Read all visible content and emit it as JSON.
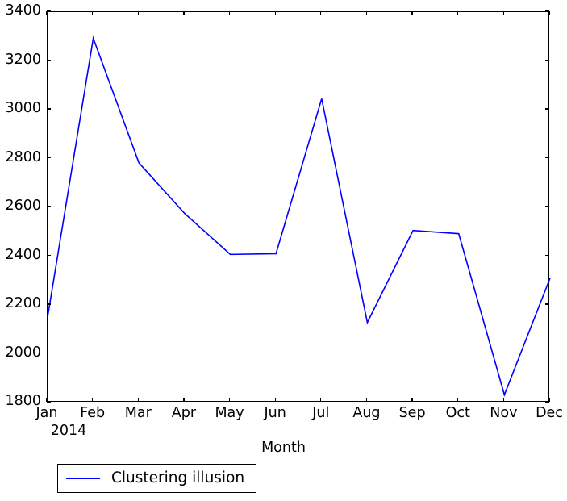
{
  "chart_data": {
    "type": "line",
    "title": "",
    "subtitle": "",
    "xlabel": "Month",
    "ylabel": "",
    "categories": [
      "Jan",
      "Feb",
      "Mar",
      "Apr",
      "May",
      "Jun",
      "Jul",
      "Aug",
      "Sep",
      "Oct",
      "Nov",
      "Dec"
    ],
    "x_year_label": "2014",
    "series": [
      {
        "name": "Clustering illusion",
        "color": "#0000ff",
        "values": [
          2150,
          3293,
          2782,
          2575,
          2407,
          2410,
          3045,
          2128,
          2505,
          2492,
          1832,
          2310
        ]
      }
    ],
    "xlim": [
      0,
      11
    ],
    "ylim": [
      1800,
      3400
    ],
    "y_ticks": [
      1800,
      2000,
      2200,
      2400,
      2600,
      2800,
      3000,
      3200,
      3400
    ],
    "y_tick_labels": [
      "1800",
      "2000",
      "2200",
      "2400",
      "2600",
      "2800",
      "3000",
      "3200",
      "3400"
    ],
    "grid": false,
    "legend_position": "below-left",
    "legend_entries": [
      "Clustering illusion"
    ]
  },
  "axes": {
    "x_axis_title": "Month",
    "year_label": "2014"
  },
  "legend": {
    "label": "Clustering illusion"
  }
}
